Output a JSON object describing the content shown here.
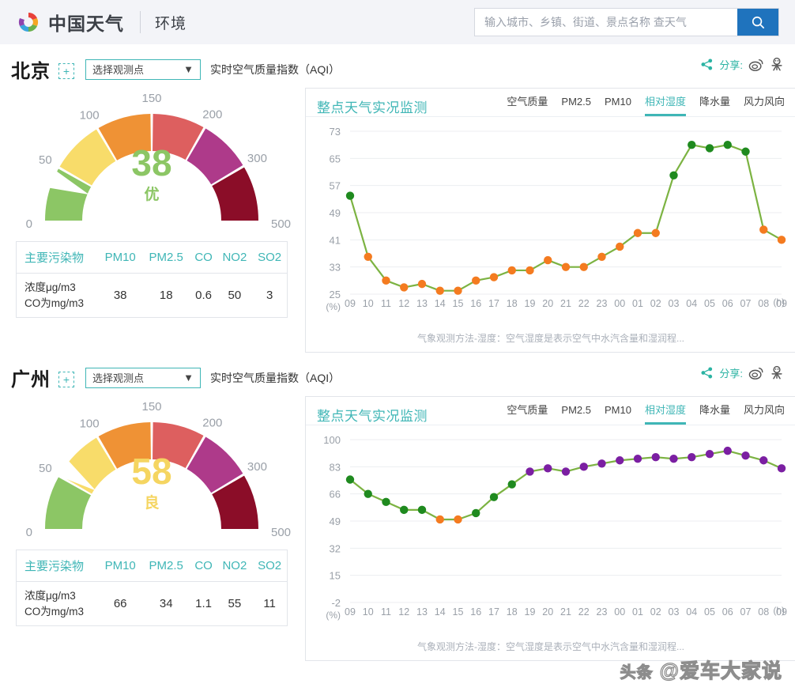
{
  "header": {
    "logo_text": "中国天气",
    "section": "环境",
    "search_placeholder": "输入城市、乡镇、街道、景点名称 查天气",
    "search_value": "",
    "search_icon": "search-icon"
  },
  "share": {
    "label": "分享:",
    "weibo": "weibo-icon",
    "other": "social-icon"
  },
  "colors": {
    "teal": "#3fb6b6",
    "blue": "#1f73bd",
    "aqi_good": "#8cc665",
    "aqi_moderate": "#f5d561",
    "line_green": "#7cb342",
    "dot_orange": "#f47b20",
    "dot_green": "#1f8a1f",
    "dot_purple": "#7b1fa2"
  },
  "gauge_scale": {
    "ticks": [
      "0",
      "50",
      "100",
      "150",
      "200",
      "300",
      "500"
    ],
    "segments": [
      {
        "from": 0,
        "to": 50,
        "color": "#8cc665"
      },
      {
        "from": 50,
        "to": 100,
        "color": "#f8dc6a"
      },
      {
        "from": 100,
        "to": 150,
        "color": "#ef9235"
      },
      {
        "from": 150,
        "to": 200,
        "color": "#dd5f5f"
      },
      {
        "from": 200,
        "to": 300,
        "color": "#ae3a8a"
      },
      {
        "from": 300,
        "to": 500,
        "color": "#8b0d28"
      }
    ]
  },
  "table_headers": [
    "主要污染物",
    "PM10",
    "PM2.5",
    "CO",
    "NO2",
    "SO2"
  ],
  "table_row_label": [
    "浓度μg/m3",
    "CO为mg/m3"
  ],
  "panel": {
    "title": "整点天气实况监测",
    "tabs": [
      {
        "label": "空气质量",
        "active": false
      },
      {
        "label": "PM2.5",
        "active": false
      },
      {
        "label": "PM10",
        "active": false
      },
      {
        "label": "相对湿度",
        "active": true
      },
      {
        "label": "降水量",
        "active": false
      },
      {
        "label": "风力风向",
        "active": false
      }
    ],
    "note": "气象观测方法-湿度：空气湿度是表示空气中水汽含量和湿润程..."
  },
  "watermark": {
    "prefix": "头条",
    "text": "@爱车大家说"
  },
  "sections": [
    {
      "city": "北京",
      "plus": "+",
      "station_select": "选择观测点",
      "aqi_label": "实时空气质量指数（AQI）",
      "gauge": {
        "value": "38",
        "category": "优",
        "value_num": 38,
        "color": "#8cc665"
      },
      "pollutants": [
        "38",
        "18",
        "0.6",
        "50",
        "3"
      ],
      "chart_data": {
        "type": "line",
        "title": "整点天气实况监测 - 相对湿度",
        "xlabel": "(h)",
        "ylabel": "(%)",
        "ylim": [
          25,
          73
        ],
        "yticks": [
          25,
          33,
          41,
          49,
          57,
          65,
          73
        ],
        "grid": true,
        "legend": "none",
        "categories": [
          "09",
          "10",
          "11",
          "12",
          "13",
          "14",
          "15",
          "16",
          "17",
          "18",
          "19",
          "20",
          "21",
          "22",
          "23",
          "00",
          "01",
          "02",
          "03",
          "04",
          "05",
          "06",
          "07",
          "08",
          "09"
        ],
        "values": [
          54,
          36,
          29,
          27,
          28,
          26,
          26,
          29,
          30,
          32,
          32,
          35,
          33,
          33,
          36,
          39,
          43,
          43,
          60,
          69,
          68,
          69,
          67,
          44,
          41
        ],
        "point_colors": [
          "#1f8a1f",
          "#f47b20",
          "#f47b20",
          "#f47b20",
          "#f47b20",
          "#f47b20",
          "#f47b20",
          "#f47b20",
          "#f47b20",
          "#f47b20",
          "#f47b20",
          "#f47b20",
          "#f47b20",
          "#f47b20",
          "#f47b20",
          "#f47b20",
          "#f47b20",
          "#f47b20",
          "#1f8a1f",
          "#1f8a1f",
          "#1f8a1f",
          "#1f8a1f",
          "#1f8a1f",
          "#f47b20",
          "#f47b20"
        ]
      }
    },
    {
      "city": "广州",
      "plus": "+",
      "station_select": "选择观测点",
      "aqi_label": "实时空气质量指数（AQI）",
      "gauge": {
        "value": "58",
        "category": "良",
        "value_num": 58,
        "color": "#f5d561"
      },
      "pollutants": [
        "66",
        "34",
        "1.1",
        "55",
        "11"
      ],
      "chart_data": {
        "type": "line",
        "title": "整点天气实况监测 - 相对湿度",
        "xlabel": "(h)",
        "ylabel": "(%)",
        "ylim": [
          -2,
          100
        ],
        "yticks": [
          -2,
          15,
          32,
          49,
          66,
          83,
          100
        ],
        "grid": true,
        "legend": "none",
        "categories": [
          "09",
          "10",
          "11",
          "12",
          "13",
          "14",
          "15",
          "16",
          "17",
          "18",
          "19",
          "20",
          "21",
          "22",
          "23",
          "00",
          "01",
          "02",
          "03",
          "04",
          "05",
          "06",
          "07",
          "08",
          "09"
        ],
        "values": [
          75,
          66,
          61,
          56,
          56,
          50,
          50,
          54,
          64,
          72,
          80,
          82,
          80,
          83,
          85,
          87,
          88,
          89,
          88,
          89,
          91,
          93,
          90,
          87,
          82
        ],
        "point_colors": [
          "#1f8a1f",
          "#1f8a1f",
          "#1f8a1f",
          "#1f8a1f",
          "#1f8a1f",
          "#f47b20",
          "#f47b20",
          "#1f8a1f",
          "#1f8a1f",
          "#1f8a1f",
          "#7b1fa2",
          "#7b1fa2",
          "#7b1fa2",
          "#7b1fa2",
          "#7b1fa2",
          "#7b1fa2",
          "#7b1fa2",
          "#7b1fa2",
          "#7b1fa2",
          "#7b1fa2",
          "#7b1fa2",
          "#7b1fa2",
          "#7b1fa2",
          "#7b1fa2",
          "#7b1fa2"
        ]
      }
    }
  ]
}
